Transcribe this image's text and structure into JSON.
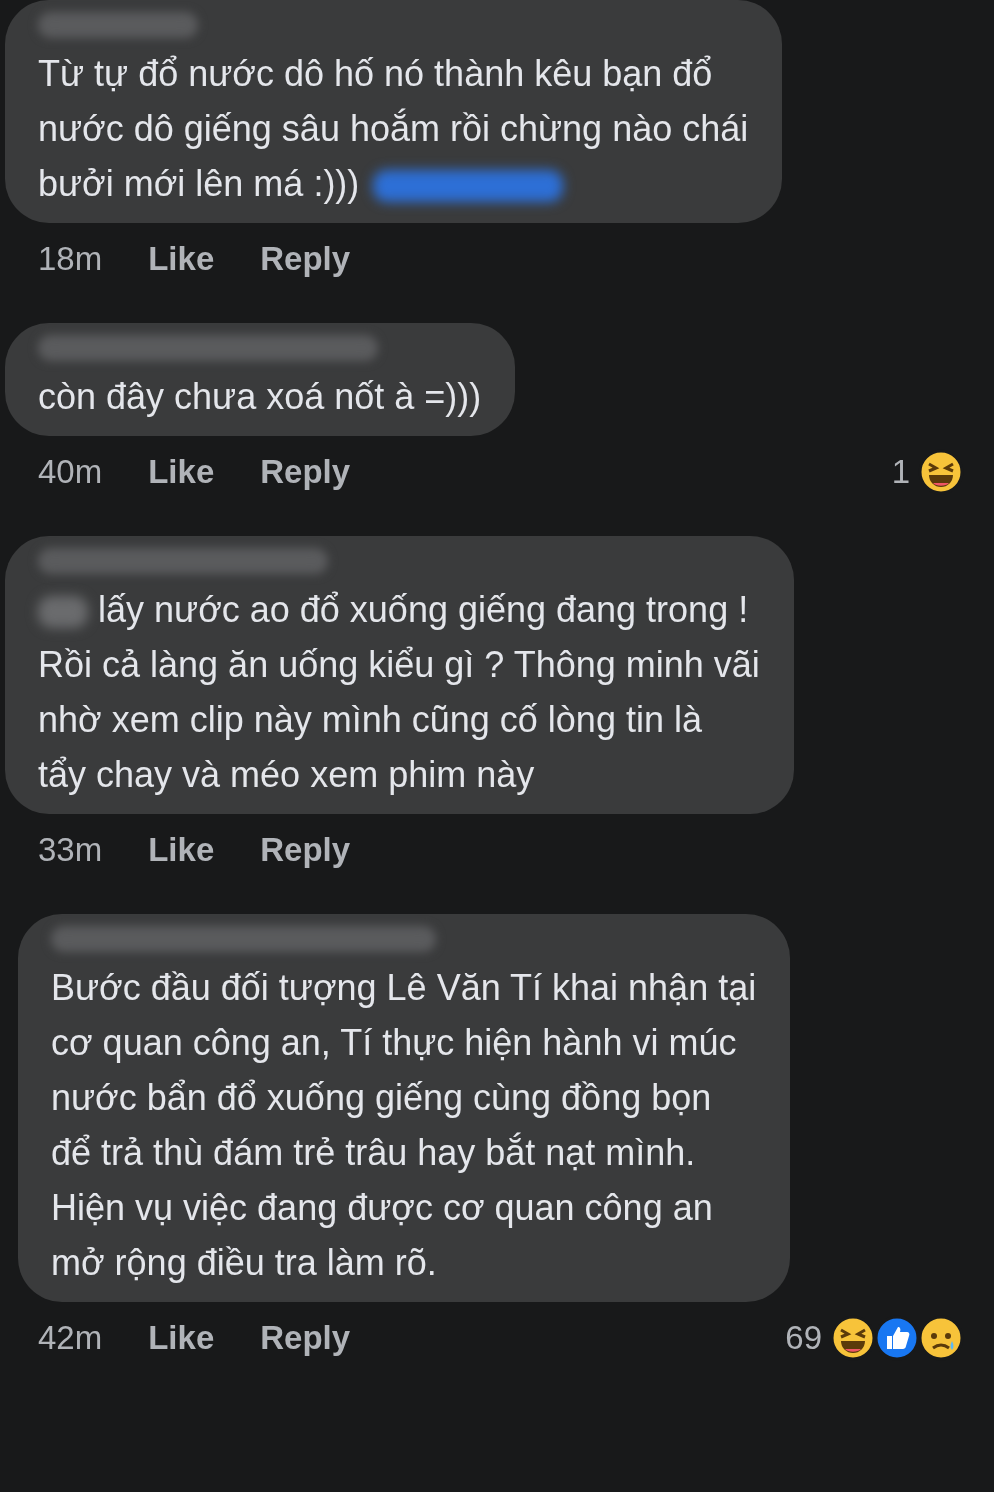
{
  "comments": [
    {
      "text": "Từ tự đổ nước dô hố nó thành kêu bạn đổ\nnước dô giếng sâu hoắm rồi chừng nào chái\nbưởi mới lên má :)))",
      "mention": {
        "kind": "trailing"
      },
      "time": "18m",
      "like": "Like",
      "reply": "Reply"
    },
    {
      "text": "còn đây chưa xoá nốt à =)))",
      "time": "40m",
      "like": "Like",
      "reply": "Reply",
      "reactions": {
        "count": "1",
        "emojis": [
          {
            "kind": "haha"
          }
        ]
      }
    },
    {
      "text": "lấy nước ao đổ xuống giếng đang trong !\nRồi cả làng ăn uống kiểu gì ? Thông minh vãi\nnhờ xem clip này mình cũng cố lòng tin là\ntẩy chay và méo xem phim này",
      "mention": {
        "kind": "leading"
      },
      "time": "33m",
      "like": "Like",
      "reply": "Reply"
    },
    {
      "text": "Bước đầu đối tượng Lê Văn Tí khai nhận tại\ncơ quan công an, Tí thực hiện hành vi múc\nnước bẩn đổ xuống giếng cùng đồng bọn\nđể trả thù đám trẻ trâu hay bắt nạt mình.\nHiện vụ việc đang được cơ quan công an\nmở rộng điều tra làm rõ.",
      "time": "42m",
      "like": "Like",
      "reply": "Reply",
      "reactions": {
        "count": "69",
        "emojis": [
          {
            "kind": "haha"
          },
          {
            "kind": "like"
          },
          {
            "kind": "sad"
          }
        ]
      }
    }
  ]
}
